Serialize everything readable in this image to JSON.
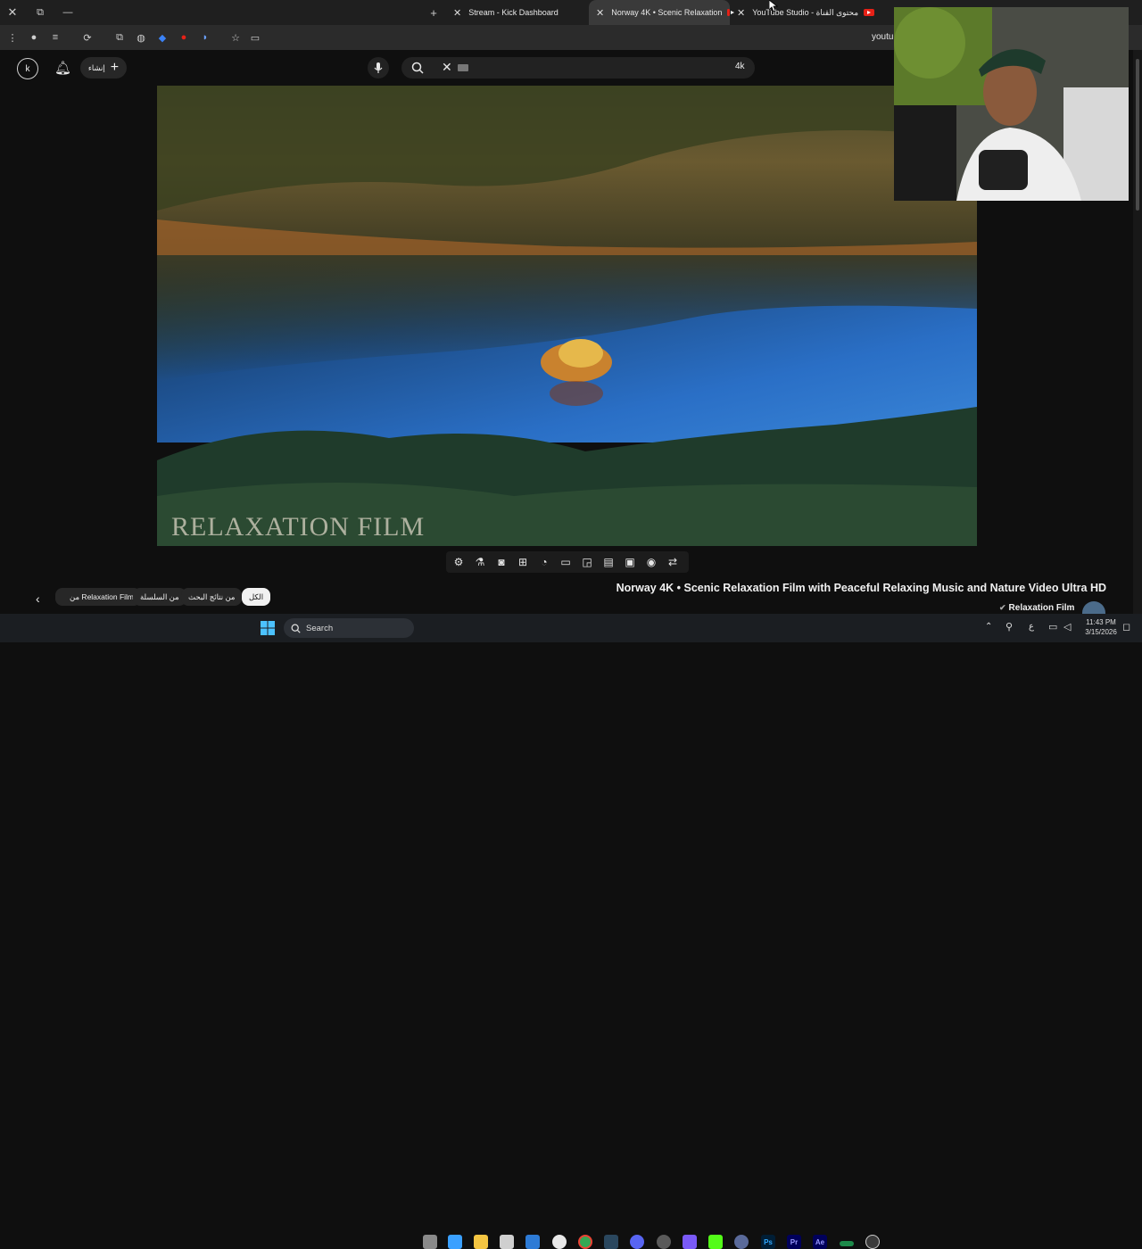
{
  "tabs": {
    "kick": {
      "label": "Stream - Kick Dashboard"
    },
    "active": {
      "label": "Norway 4K • Scenic Relaxation"
    },
    "studio": {
      "label": "YouTube Studio - محتوى القناة"
    }
  },
  "address": {
    "domain": "youtu"
  },
  "header": {
    "create_label": "إنشاء",
    "search_value": "4k"
  },
  "video": {
    "watermark": "RELAXATION FILM",
    "title": "Norway 4K • Scenic Relaxation Film with Peaceful Relaxing Music and Nature Video Ultra HD"
  },
  "channel": {
    "name": "Relaxation Film"
  },
  "chips": [
    {
      "label": "الكل"
    },
    {
      "label": "من نتائج البحث"
    },
    {
      "label": "من السلسلة"
    },
    {
      "label": "من Relaxation Film"
    }
  ],
  "taskbar": {
    "search_label": "Search",
    "lang": "ع",
    "time": "11:43 PM",
    "date": "3/15/2026"
  },
  "icons": [
    "close-icon",
    "restore-icon",
    "minimize-icon",
    "new-tab-icon",
    "menu-icon",
    "star-icon",
    "mic-icon",
    "search-icon",
    "bell-icon",
    "plus-icon",
    "settings-icon",
    "camera-icon",
    "loop-icon",
    "windows-icon"
  ],
  "colors": {
    "accent_red": "#e62117",
    "kick_green": "#53fc18",
    "bg": "#0f0f0f"
  }
}
